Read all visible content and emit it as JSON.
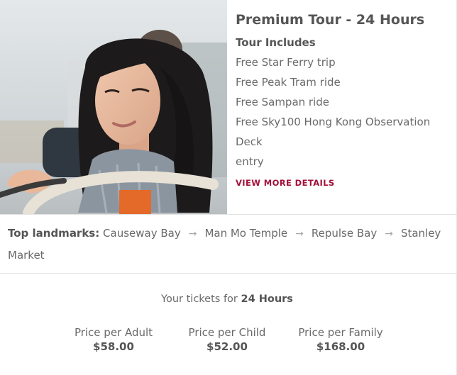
{
  "tour": {
    "title": "Premium Tour - 24 Hours",
    "includes_title": "Tour Includes",
    "includes": [
      "Free Star Ferry trip",
      "Free Peak Tram ride",
      "Free Sampan ride",
      "Free Sky100 Hong Kong Observation Deck",
      "entry"
    ],
    "view_more_label": "VIEW MORE DETAILS"
  },
  "landmarks": {
    "label": "Top landmarks:",
    "stops": [
      "Causeway Bay",
      "Man Mo Temple",
      "Repulse Bay",
      "Stanley Market"
    ],
    "arrow_icon": "arrow-right-icon"
  },
  "tickets": {
    "heading_prefix": "Your tickets for",
    "heading_duration": "24 Hours",
    "prices": [
      {
        "label": "Price per Adult",
        "value": "$58.00"
      },
      {
        "label": "Price per Child",
        "value": "$52.00"
      },
      {
        "label": "Price per Family",
        "value": "$168.00"
      }
    ]
  },
  "colors": {
    "accent": "#a3103a",
    "text": "#6a6a6a",
    "heading": "#555555"
  },
  "image": {
    "icon": "tour-photo-woman-on-open-top-bus"
  }
}
